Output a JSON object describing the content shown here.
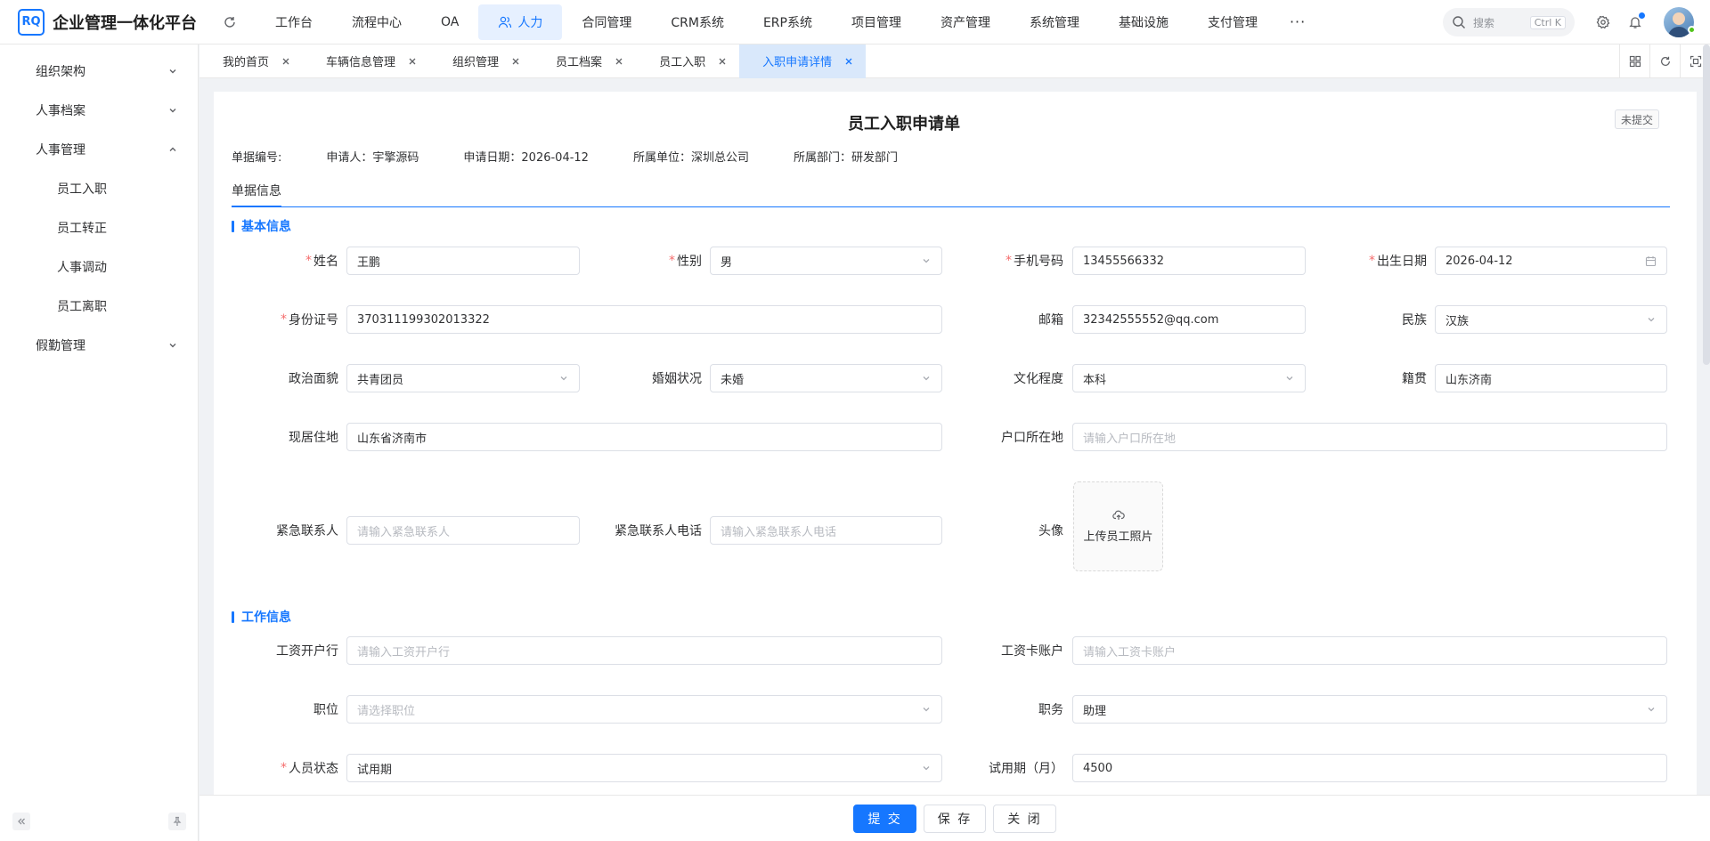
{
  "app": {
    "logo_mark": "RQ",
    "title": "企业管理一体化平台"
  },
  "nav": [
    {
      "label": "工作台"
    },
    {
      "label": "流程中心"
    },
    {
      "label": "OA"
    },
    {
      "label": "人力"
    },
    {
      "label": "合同管理"
    },
    {
      "label": "CRM系统"
    },
    {
      "label": "ERP系统"
    },
    {
      "label": "项目管理"
    },
    {
      "label": "资产管理"
    },
    {
      "label": "系统管理"
    },
    {
      "label": "基础设施"
    },
    {
      "label": "支付管理"
    }
  ],
  "nav_active": "人力",
  "nav_more": "···",
  "search": {
    "placeholder": "搜索",
    "shortcut": "Ctrl K"
  },
  "sidebar": {
    "items": [
      {
        "label": "组织架构"
      },
      {
        "label": "人事档案"
      },
      {
        "label": "人事管理"
      },
      {
        "label": "假勤管理"
      }
    ],
    "sub_items": [
      {
        "label": "员工入职"
      },
      {
        "label": "员工转正"
      },
      {
        "label": "人事调动"
      },
      {
        "label": "员工离职"
      }
    ]
  },
  "tabs": [
    {
      "label": "我的首页"
    },
    {
      "label": "车辆信息管理"
    },
    {
      "label": "组织管理"
    },
    {
      "label": "员工档案"
    },
    {
      "label": "员工入职"
    },
    {
      "label": "入职申请详情"
    }
  ],
  "form": {
    "title": "员工入职申请单",
    "status": "未提交",
    "meta": {
      "doc_no": "单据编号:",
      "applicant": "申请人：宇擎源码",
      "apply_date": "申请日期：2026-04-12",
      "unit": "所属单位：深圳总公司",
      "dept": "所属部门：研发部门"
    },
    "inner_tab": "单据信息",
    "sections": {
      "basic": "基本信息",
      "work": "工作信息"
    },
    "required_mark": "*",
    "fields": {
      "name": {
        "label": "姓名",
        "value": "王鹏"
      },
      "gender": {
        "label": "性别",
        "value": "男"
      },
      "phone": {
        "label": "手机号码",
        "value": "13455566332"
      },
      "birth": {
        "label": "出生日期",
        "value": "2026-04-12"
      },
      "id_card": {
        "label": "身份证号",
        "value": "370311199302013322"
      },
      "email": {
        "label": "邮箱",
        "value": "32342555552@qq.com"
      },
      "ethnic": {
        "label": "民族",
        "value": "汉族"
      },
      "political": {
        "label": "政治面貌",
        "value": "共青团员"
      },
      "marital": {
        "label": "婚姻状况",
        "value": "未婚"
      },
      "education": {
        "label": "文化程度",
        "value": "本科"
      },
      "native": {
        "label": "籍贯",
        "value": "山东济南"
      },
      "address": {
        "label": "现居住地",
        "value": "山东省济南市"
      },
      "hukou": {
        "label": "户口所在地",
        "placeholder": "请输入户口所在地"
      },
      "emergency_contact": {
        "label": "紧急联系人",
        "placeholder": "请输入紧急联系人"
      },
      "emergency_phone": {
        "label": "紧急联系人电话",
        "placeholder": "请输入紧急联系人电话"
      },
      "avatar": {
        "label": "头像",
        "upload_text": "上传员工照片"
      },
      "bank": {
        "label": "工资开户行",
        "placeholder": "请输入工资开户行"
      },
      "account": {
        "label": "工资卡账户",
        "placeholder": "请输入工资卡账户"
      },
      "position": {
        "label": "职位",
        "placeholder": "请选择职位"
      },
      "job": {
        "label": "职务",
        "value": "助理"
      },
      "staff_status": {
        "label": "人员状态",
        "value": "试用期"
      },
      "probation": {
        "label": "试用期（月）",
        "value": "4500"
      }
    }
  },
  "actions": {
    "submit": "提 交",
    "save": "保 存",
    "close": "关 闭"
  },
  "colors": {
    "primary": "#1677ff",
    "required": "#f56c6c",
    "active_tab_bg": "#d9e8fb"
  }
}
